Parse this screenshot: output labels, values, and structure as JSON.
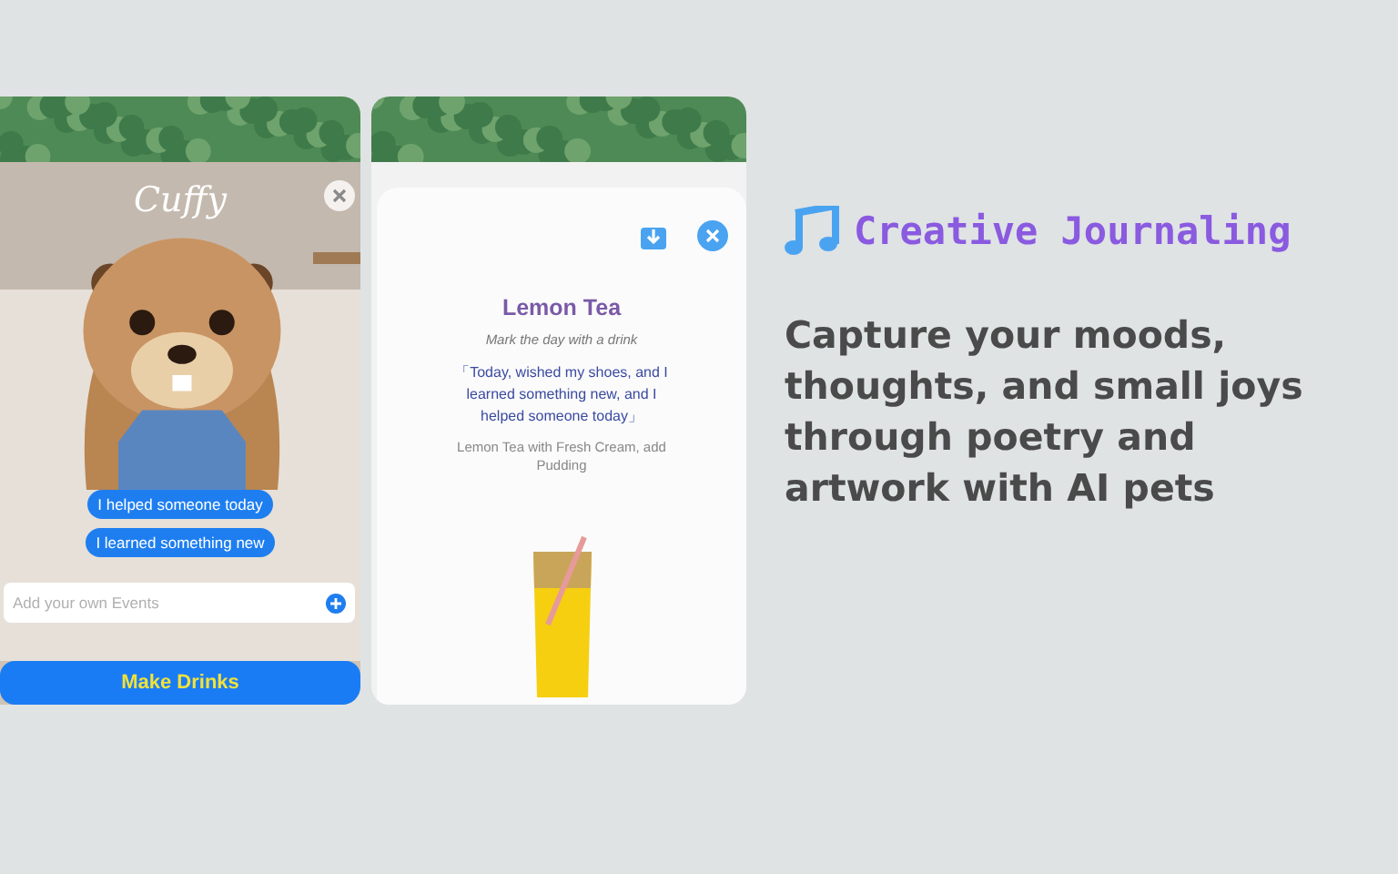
{
  "pet_card": {
    "pet_name": "Cuffy",
    "event_chips": [
      "I helped someone today",
      "I learned something new"
    ],
    "event_input": {
      "placeholder": "Add your own Events"
    },
    "action_button": "Make Drinks"
  },
  "drink_card": {
    "title": "Lemon Tea",
    "subtitle": "Mark the day with a drink",
    "quote": "「Today, wished my shoes, and I learned something new, and I helped someone today」",
    "description": "Lemon Tea with Fresh Cream, add Pudding"
  },
  "feature": {
    "heading": "Creative Journaling",
    "body": "Capture your moods, thoughts, and small joys through poetry and artwork with AI pets"
  }
}
